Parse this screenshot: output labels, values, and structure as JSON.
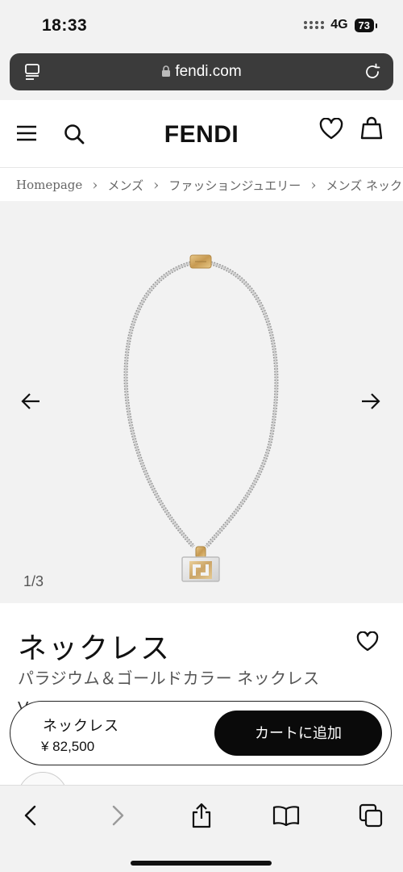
{
  "status_bar": {
    "time": "18:33",
    "network": "4G",
    "battery": "73"
  },
  "browser": {
    "url": "fendi.com"
  },
  "header": {
    "brand": "FENDI"
  },
  "breadcrumb": [
    "Homepage",
    "メンズ",
    "ファッションジュエリー",
    "メンズ ネックレス"
  ],
  "gallery": {
    "counter": "1/3"
  },
  "product": {
    "title": "ネックレス",
    "subtitle": "パラジウム＆ゴールドカラー ネックレス",
    "peek_text": "V"
  },
  "cart_bar": {
    "name": "ネックレス",
    "price": "¥ 82,500",
    "button_label": "カートに追加"
  },
  "colors": {
    "accent": "#0a0a0a",
    "background": "#f2f2f2",
    "url_bar": "#3b3b3b"
  }
}
